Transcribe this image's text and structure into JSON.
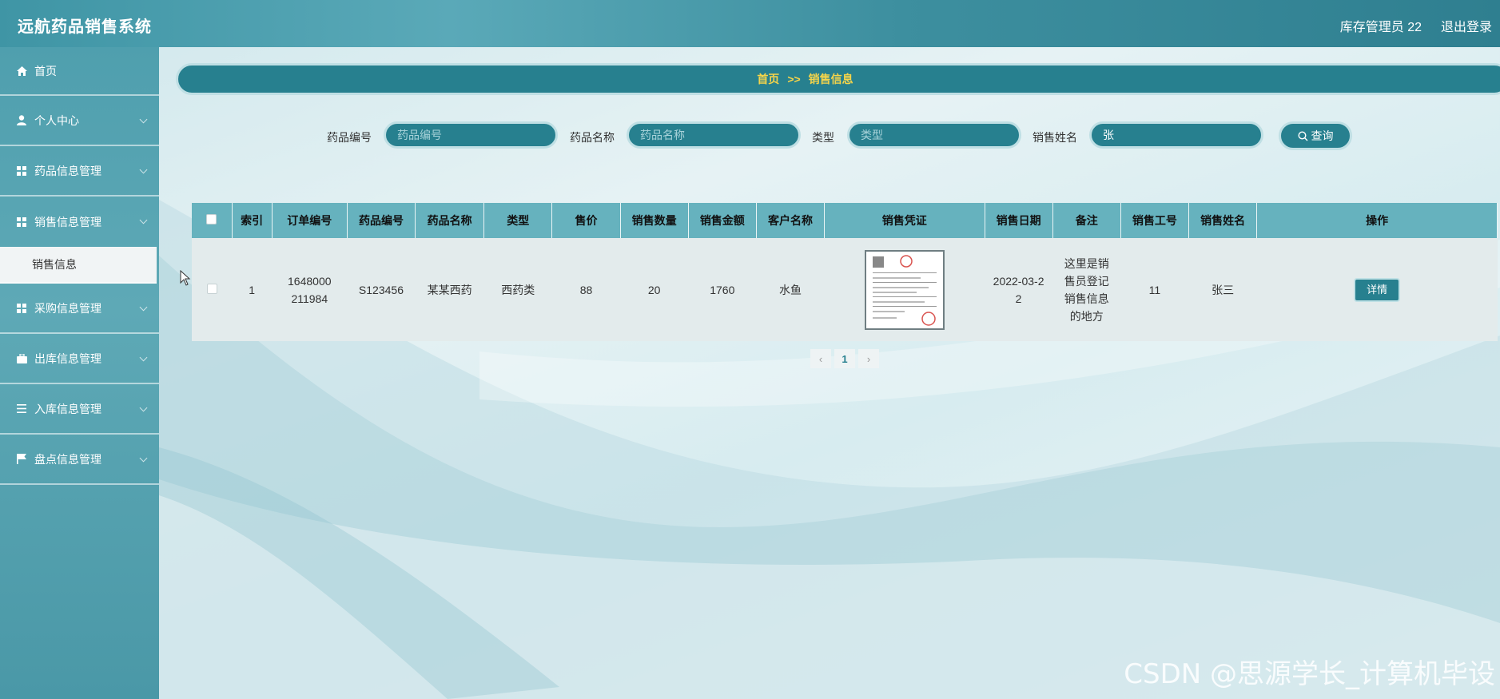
{
  "app": {
    "title": "远航药品销售系统"
  },
  "header": {
    "user": "库存管理员 22",
    "logout": "退出登录"
  },
  "sidebar": {
    "items": [
      {
        "label": "首页",
        "icon": "home-icon"
      },
      {
        "label": "个人中心",
        "icon": "user-icon"
      },
      {
        "label": "药品信息管理",
        "icon": "grid-icon"
      },
      {
        "label": "销售信息管理",
        "icon": "grid-icon",
        "sub": "销售信息"
      },
      {
        "label": "采购信息管理",
        "icon": "grid-icon"
      },
      {
        "label": "出库信息管理",
        "icon": "briefcase-icon"
      },
      {
        "label": "入库信息管理",
        "icon": "list-icon"
      },
      {
        "label": "盘点信息管理",
        "icon": "flag-icon"
      }
    ]
  },
  "breadcrumb": {
    "home": "首页",
    "sep": ">>",
    "current": "销售信息"
  },
  "search": {
    "fields": [
      {
        "label": "药品编号",
        "placeholder": "药品编号",
        "value": ""
      },
      {
        "label": "药品名称",
        "placeholder": "药品名称",
        "value": ""
      },
      {
        "label": "类型",
        "placeholder": "类型",
        "value": ""
      },
      {
        "label": "销售姓名",
        "placeholder": "销售姓名",
        "value": "张"
      }
    ],
    "button": "查询"
  },
  "table": {
    "headers": [
      "索引",
      "订单编号",
      "药品编号",
      "药品名称",
      "类型",
      "售价",
      "销售数量",
      "销售金额",
      "客户名称",
      "销售凭证",
      "销售日期",
      "备注",
      "销售工号",
      "销售姓名",
      "操作"
    ],
    "rows": [
      {
        "index": "1",
        "order_no": "1648000211984",
        "drug_no": "S123456",
        "drug_name": "某某西药",
        "type": "西药类",
        "price": "88",
        "qty": "20",
        "amount": "1760",
        "customer": "水鱼",
        "date": "2022-03-22",
        "note": "这里是销售员登记销售信息的地方",
        "emp_no": "11",
        "emp_name": "张三",
        "action": "详情"
      }
    ]
  },
  "pager": {
    "prev": "‹",
    "page": "1",
    "next": "›"
  },
  "watermark": "CSDN @思源学长_计算机毕设",
  "colors": {
    "primary": "#27808f",
    "crumb_text": "#f5d44a",
    "header_row": "#66b2be"
  }
}
